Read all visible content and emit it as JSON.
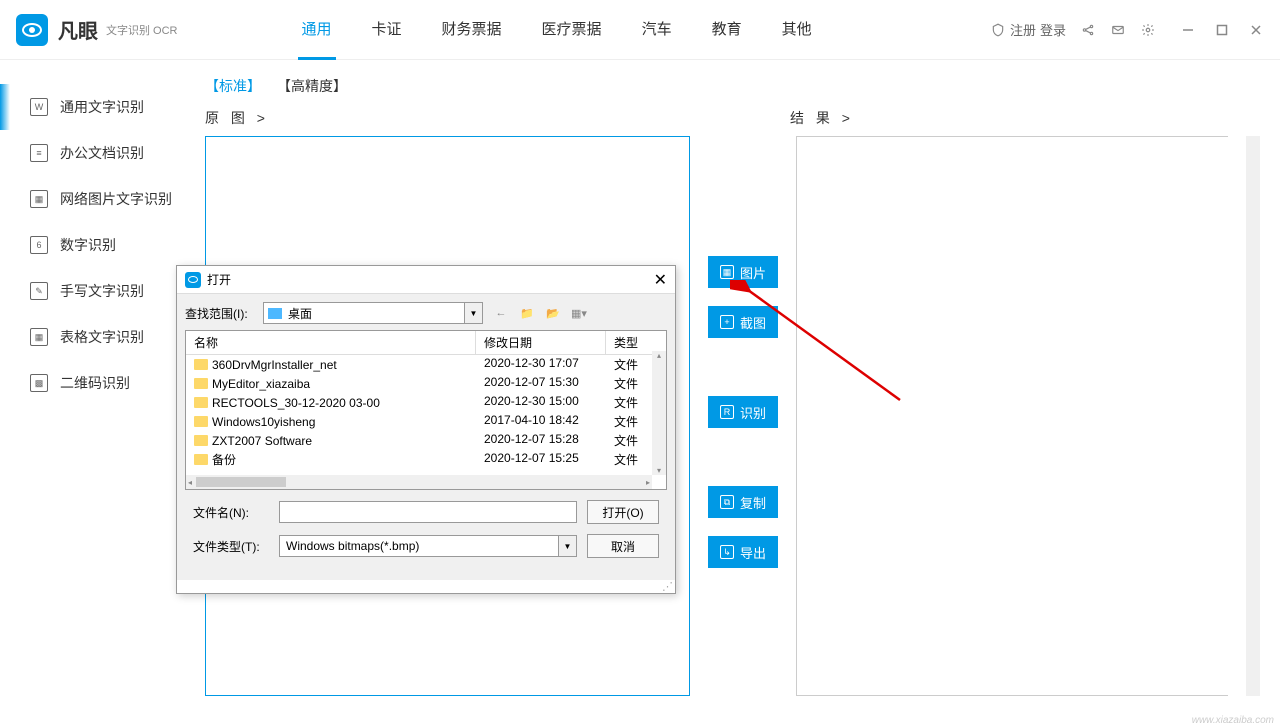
{
  "app": {
    "name": "凡眼",
    "subtitle": "文字识别 OCR"
  },
  "topNav": [
    "通用",
    "卡证",
    "财务票据",
    "医疗票据",
    "汽车",
    "教育",
    "其他"
  ],
  "titleRight": {
    "register": "注册",
    "login": "登录"
  },
  "sidebar": [
    {
      "ico": "W",
      "label": "通用文字识别"
    },
    {
      "ico": "≡",
      "label": "办公文档识别"
    },
    {
      "ico": "▦",
      "label": "网络图片文字识别"
    },
    {
      "ico": "6",
      "label": "数字识别"
    },
    {
      "ico": "✎",
      "label": "手写文字识别"
    },
    {
      "ico": "▦",
      "label": "表格文字识别"
    },
    {
      "ico": "▩",
      "label": "二维码识别"
    }
  ],
  "modes": {
    "standard": "【标准】",
    "high": "【高精度】"
  },
  "panels": {
    "orig": "原 图 >",
    "result": "结 果 >"
  },
  "actions": [
    "图片",
    "截图",
    "识别",
    "复制",
    "导出"
  ],
  "openDialog": {
    "title": "打开",
    "lookInLabel": "查找范围(I):",
    "lookInValue": "桌面",
    "cols": {
      "name": "名称",
      "date": "修改日期",
      "type": "类型"
    },
    "rows": [
      {
        "name": "360DrvMgrInstaller_net",
        "date": "2020-12-30 17:07",
        "type": "文件"
      },
      {
        "name": "MyEditor_xiazaiba",
        "date": "2020-12-07 15:30",
        "type": "文件"
      },
      {
        "name": "RECTOOLS_30-12-2020 03-00",
        "date": "2020-12-30 15:00",
        "type": "文件"
      },
      {
        "name": "Windows10yisheng",
        "date": "2017-04-10 18:42",
        "type": "文件"
      },
      {
        "name": "ZXT2007 Software",
        "date": "2020-12-07 15:28",
        "type": "文件"
      },
      {
        "name": "备份",
        "date": "2020-12-07 15:25",
        "type": "文件"
      }
    ],
    "fileNameLabel": "文件名(N):",
    "fileTypeLabel": "文件类型(T):",
    "fileTypeValue": "Windows bitmaps(*.bmp)",
    "openBtn": "打开(O)",
    "cancelBtn": "取消"
  },
  "watermark": "www.xiazaiba.com"
}
